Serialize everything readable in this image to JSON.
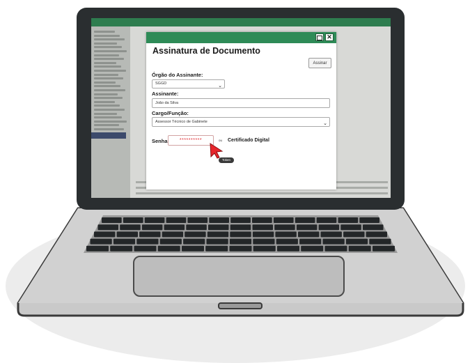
{
  "dialog": {
    "title": "Assinatura de Documento",
    "sign_button": "Assinar",
    "window_buttons": {
      "maximize_icon": "square-icon",
      "close_label": "✕"
    }
  },
  "form": {
    "orgao_label": "Órgão do Assinante:",
    "orgao_value": "SGGD",
    "assinante_label": "Assinante:",
    "assinante_value": "João da Silva",
    "cargo_label": "Cargo/Função:",
    "cargo_value": "Assessor Técnico de Gabinete",
    "senha_label": "Senha",
    "senha_value": "**********",
    "ou_label": "ou",
    "certificado_label": "Certificado Digital",
    "token_tooltip": "Token"
  },
  "colors": {
    "header_green": "#2e8b57",
    "password_red": "#e0242b",
    "cursor_red": "#e8262c",
    "laptop_frame": "#2a2e30"
  },
  "icons": [
    "square-icon",
    "close-icon",
    "chevron-down-icon",
    "pointer-cursor-icon"
  ]
}
